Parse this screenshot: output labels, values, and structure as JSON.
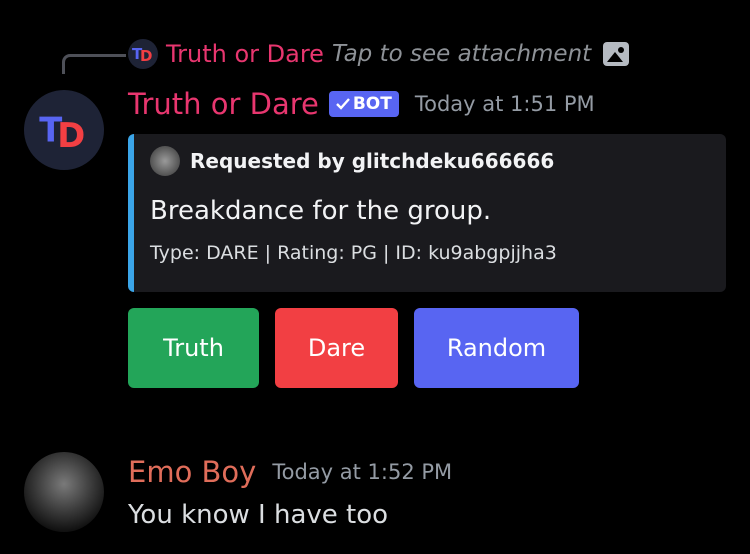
{
  "reply": {
    "avatar_text": "TD",
    "author": "Truth or Dare",
    "preview": "Tap to see attachment",
    "icon": "image-icon"
  },
  "bot_message": {
    "avatar_text": "TD",
    "author": "Truth or Dare",
    "author_color": "#e8366f",
    "badge": "BOT",
    "badge_icon": "checkmark-icon",
    "timestamp": "Today at 1:51 PM",
    "embed": {
      "accent_color": "#3ba5e8",
      "author": "Requested by glitchdeku666666",
      "description": "Breakdance for the group.",
      "footer": "Type: DARE | Rating: PG | ID: ku9abgpjjha3"
    },
    "buttons": [
      {
        "label": "Truth",
        "color": "#23a559"
      },
      {
        "label": "Dare",
        "color": "#f23f43"
      },
      {
        "label": "Random",
        "color": "#5865f2"
      }
    ]
  },
  "user_message": {
    "author": "Emo Boy",
    "author_color": "#e06d5a",
    "timestamp": "Today at 1:52 PM",
    "text": "You know I have too"
  }
}
